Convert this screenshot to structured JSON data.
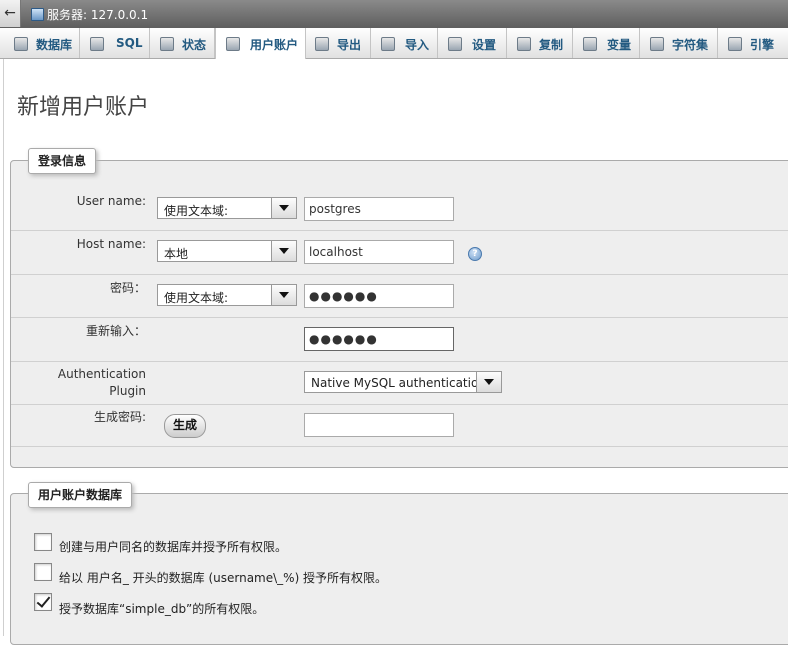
{
  "window": {
    "back_glyph": "←",
    "server_title": "服务器: 127.0.0.1"
  },
  "tabs": [
    {
      "label": "数据库",
      "icon": "database-icon"
    },
    {
      "label": "SQL",
      "icon": "sql-icon"
    },
    {
      "label": "状态",
      "icon": "status-icon"
    },
    {
      "label": "用户账户",
      "icon": "users-icon",
      "active": true
    },
    {
      "label": "导出",
      "icon": "export-icon"
    },
    {
      "label": "导入",
      "icon": "import-icon"
    },
    {
      "label": "设置",
      "icon": "settings-icon"
    },
    {
      "label": "复制",
      "icon": "replication-icon"
    },
    {
      "label": "变量",
      "icon": "variables-icon"
    },
    {
      "label": "字符集",
      "icon": "charset-icon"
    },
    {
      "label": "引擎",
      "icon": "engine-icon"
    }
  ],
  "page_title": "新增用户账户",
  "login": {
    "legend": "登录信息",
    "username_label": "User name:",
    "username_mode": "使用文本域:",
    "username_value": "postgres",
    "host_label": "Host name:",
    "host_mode": "本地",
    "host_value": "localhost",
    "password_label": "密码：",
    "password_mode": "使用文本域:",
    "password_value": "●●●●●●",
    "retype_label": "重新输入：",
    "retype_value": "●●●●●●",
    "auth_label_line1": "Authentication",
    "auth_label_line2": "Plugin",
    "auth_value": "Native MySQL authentication",
    "generate_label": "生成密码:",
    "generate_button": "生成",
    "generate_value": ""
  },
  "database": {
    "legend": "用户账户数据库",
    "options": [
      {
        "label": "创建与用户同名的数据库并授予所有权限。",
        "checked": false
      },
      {
        "label": "给以 用户名_ 开头的数据库 (username\\_%) 授予所有权限。",
        "checked": false
      },
      {
        "label": "授予数据库“simple_db”的所有权限。",
        "checked": true
      }
    ]
  },
  "colors": {
    "tab_text": "#235a81",
    "panel_bg": "#eeeeee",
    "topbar": "#6b6b6b"
  }
}
